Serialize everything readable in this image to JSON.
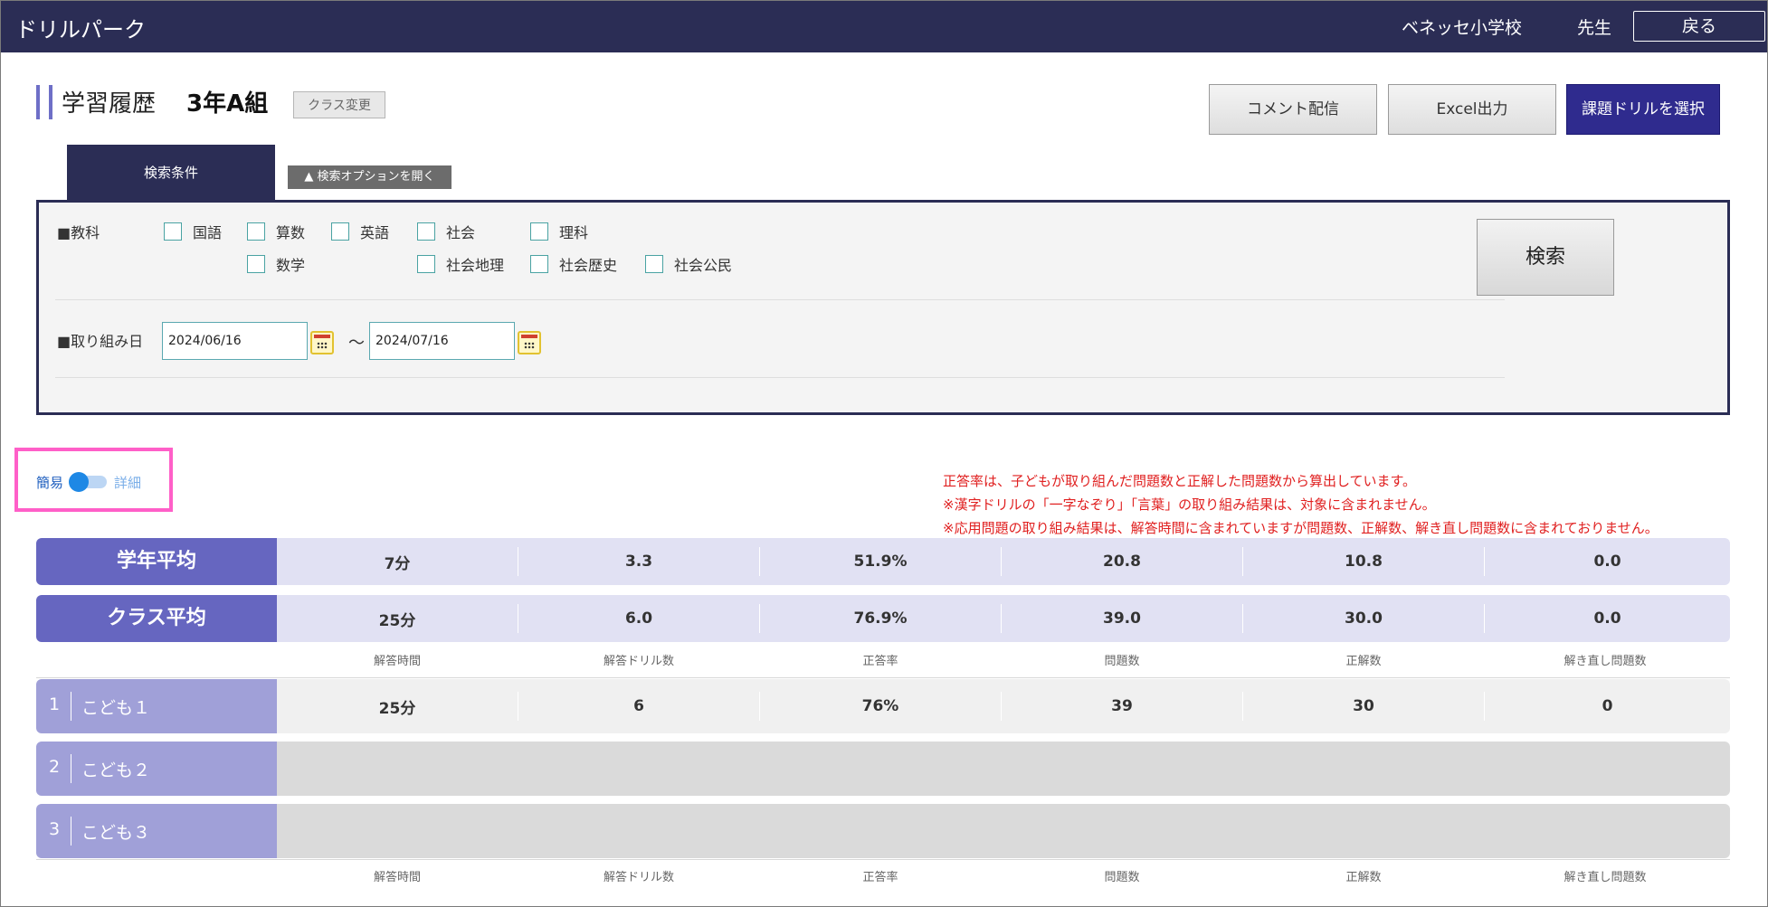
{
  "header": {
    "logo": "ドリルパーク",
    "school": "ベネッセ小学校",
    "user": "先生",
    "back_label": "戻る"
  },
  "page": {
    "title": "学習履歴",
    "class_name": "3年A組",
    "class_change_label": "クラス変更",
    "buttons": {
      "comment": "コメント配信",
      "excel": "Excel出力",
      "select_drill": "課題ドリルを選択"
    }
  },
  "search": {
    "tab_label": "検索条件",
    "option_label": "▲ 検索オプションを開く",
    "subject_label": "■教科",
    "subjects": [
      "国語",
      "算数",
      "英語",
      "社会",
      "理科",
      "数学",
      "社会地理",
      "社会歴史",
      "社会公民"
    ],
    "date_label": "■取り組み日",
    "date_from": "2024/06/16",
    "date_to": "2024/07/16",
    "tilde": "～",
    "search_button": "検索"
  },
  "toggle": {
    "simple": "簡易",
    "detail": "詳細",
    "state": "簡易"
  },
  "notes": [
    "正答率は、子どもが取り組んだ問題数と正解した問題数から算出しています。",
    "※漢字ドリルの「一字なぞり」「言葉」の取り組み結果は、対象に含まれません。",
    "※応用問題の取り組み結果は、解答時間に含まれていますが問題数、正解数、解き直し問題数に含まれておりません。"
  ],
  "averages": [
    {
      "label": "学年平均",
      "values": [
        "7分",
        "3.3",
        "51.9%",
        "20.8",
        "10.8",
        "0.0"
      ]
    },
    {
      "label": "クラス平均",
      "values": [
        "25分",
        "6.0",
        "76.9%",
        "39.0",
        "30.0",
        "0.0"
      ]
    }
  ],
  "columns": [
    "解答時間",
    "解答ドリル数",
    "正答率",
    "問題数",
    "正解数",
    "解き直し問題数"
  ],
  "students": [
    {
      "num": "1",
      "name": "こども１",
      "values": [
        "25分",
        "6",
        "76%",
        "39",
        "30",
        "0"
      ]
    },
    {
      "num": "2",
      "name": "こども２",
      "values": [
        "",
        "",
        "",
        "",
        "",
        ""
      ]
    },
    {
      "num": "3",
      "name": "こども３",
      "values": [
        "",
        "",
        "",
        "",
        "",
        ""
      ]
    }
  ]
}
